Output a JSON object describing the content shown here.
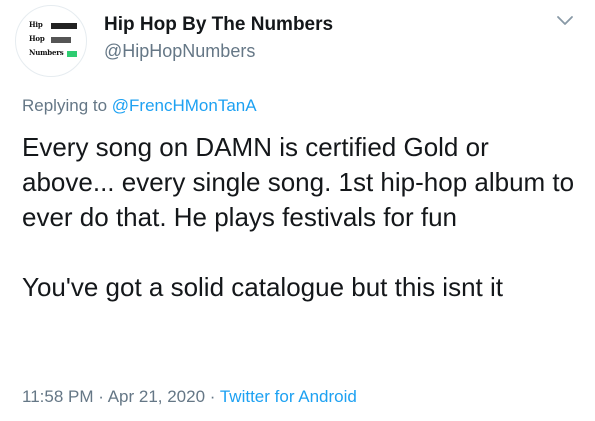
{
  "author": {
    "display_name": "Hip Hop By The Numbers",
    "handle": "@HipHopNumbers",
    "avatar_logo_lines": [
      "Hip",
      "Hop",
      "Numbers"
    ]
  },
  "reply": {
    "prefix": "Replying to ",
    "mention": "@FrencHMonTanA"
  },
  "tweet": {
    "paragraph_1": "Every song on DAMN is certified Gold or above... every single song. 1st hip-hop album to ever do that. He plays festivals for fun",
    "paragraph_2": "You've got a solid catalogue but this isnt it"
  },
  "meta": {
    "time": "11:58 PM",
    "separator": " · ",
    "date": "Apr 21, 2020",
    "source": "Twitter for Android"
  },
  "icons": {
    "menu": "chevron-down-icon"
  },
  "colors": {
    "text_primary": "#14171a",
    "text_secondary": "#657786",
    "link": "#1da1f2",
    "logo_accent": "#2ecc71"
  }
}
